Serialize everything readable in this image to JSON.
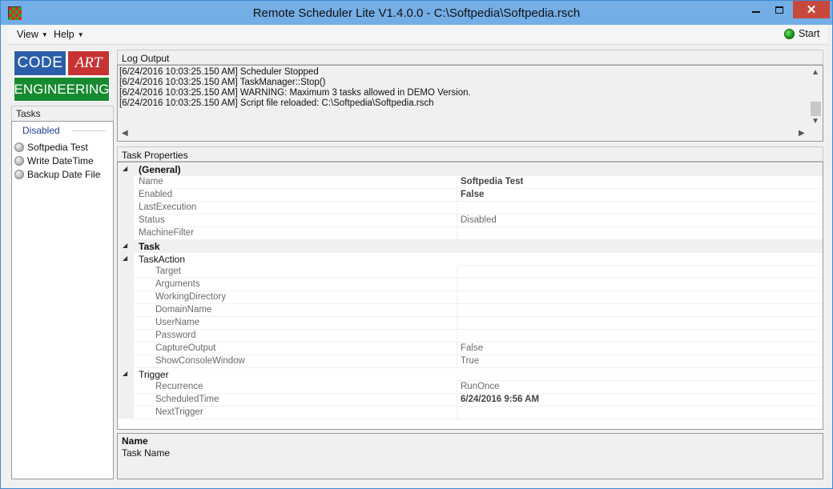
{
  "window": {
    "title": "Remote Scheduler Lite V1.4.0.0 - C:\\Softpedia\\Softpedia.rsch",
    "close_label": "✕"
  },
  "menu": {
    "view_label": "View",
    "help_label": "Help",
    "start_label": "Start"
  },
  "logo": {
    "code": "CODE",
    "art": "ART",
    "engineering": "ENGINEERING"
  },
  "tasks": {
    "header": "Tasks",
    "group_label": "Disabled",
    "items": [
      {
        "label": "Softpedia Test"
      },
      {
        "label": "Write DateTime"
      },
      {
        "label": "Backup Date File"
      }
    ]
  },
  "log": {
    "header": "Log Output",
    "lines": [
      "[6/24/2016 10:03:25.150 AM] Scheduler Stopped",
      "[6/24/2016 10:03:25.150 AM] TaskManager::Stop()",
      "[6/24/2016 10:03:25.150 AM] WARNING: Maximum 3 tasks allowed in DEMO Version.",
      "[6/24/2016 10:03:25.150 AM] Script file reloaded: C:\\Softpedia\\Softpedia.rsch"
    ]
  },
  "properties": {
    "header": "Task Properties",
    "rows": [
      {
        "kind": "category",
        "name": "(General)"
      },
      {
        "kind": "prop",
        "name": "Name",
        "value": "Softpedia Test",
        "bold": true
      },
      {
        "kind": "prop",
        "name": "Enabled",
        "value": "False",
        "bold": true
      },
      {
        "kind": "prop",
        "name": "LastExecution",
        "value": ""
      },
      {
        "kind": "prop",
        "name": "Status",
        "value": "Disabled"
      },
      {
        "kind": "prop",
        "name": "MachineFilter",
        "value": ""
      },
      {
        "kind": "category",
        "name": "Task"
      },
      {
        "kind": "subcategory",
        "name": "TaskAction"
      },
      {
        "kind": "subprop",
        "name": "Target",
        "value": ""
      },
      {
        "kind": "subprop",
        "name": "Arguments",
        "value": ""
      },
      {
        "kind": "subprop",
        "name": "WorkingDirectory",
        "value": ""
      },
      {
        "kind": "subprop",
        "name": "DomainName",
        "value": ""
      },
      {
        "kind": "subprop",
        "name": "UserName",
        "value": ""
      },
      {
        "kind": "subprop",
        "name": "Password",
        "value": ""
      },
      {
        "kind": "subprop",
        "name": "CaptureOutput",
        "value": "False"
      },
      {
        "kind": "subprop",
        "name": "ShowConsoleWindow",
        "value": "True"
      },
      {
        "kind": "subcategory",
        "name": "Trigger"
      },
      {
        "kind": "subprop",
        "name": "Recurrence",
        "value": "RunOnce"
      },
      {
        "kind": "subprop",
        "name": "ScheduledTime",
        "value": "6/24/2016 9:56 AM",
        "bold": true
      },
      {
        "kind": "subprop",
        "name": "NextTrigger",
        "value": ""
      }
    ]
  },
  "description": {
    "title": "Name",
    "text": "Task Name"
  }
}
